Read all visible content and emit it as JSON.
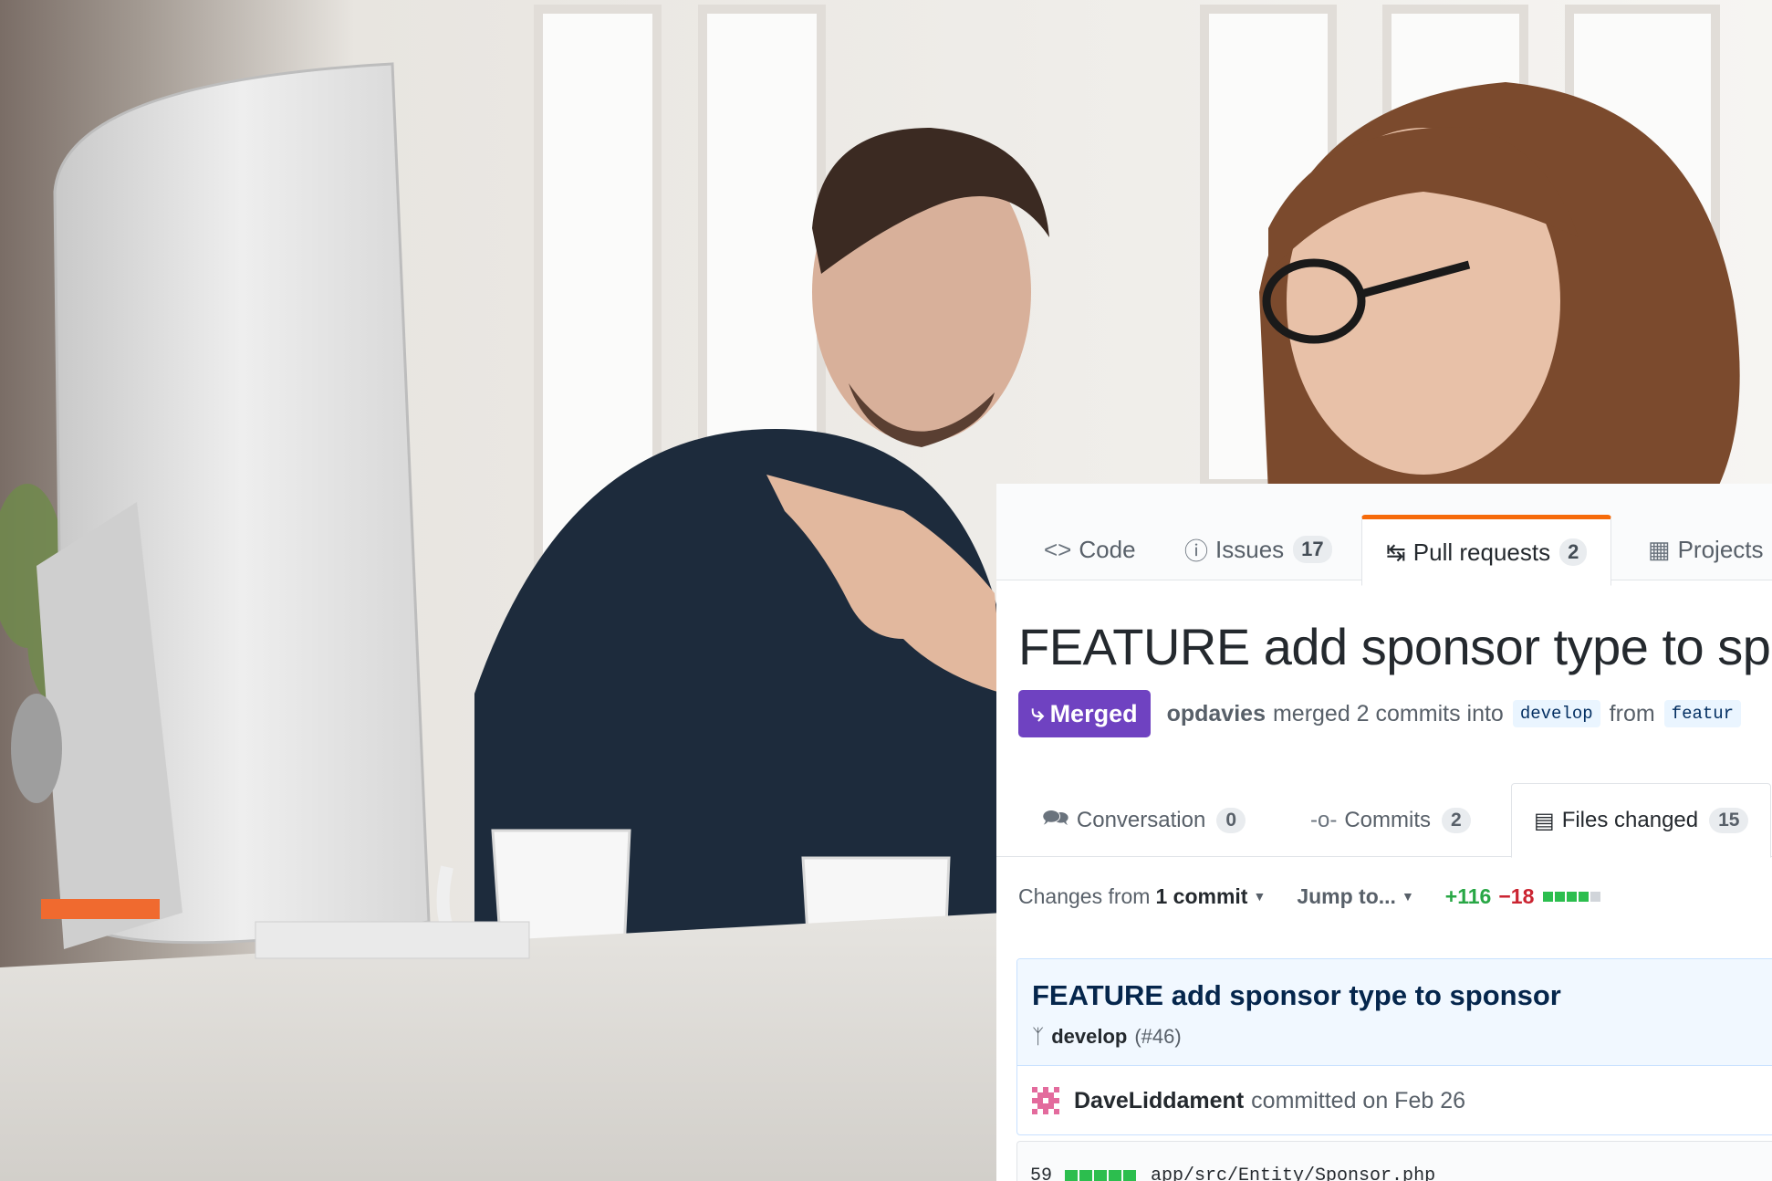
{
  "repo_tabs": {
    "code": {
      "label": "Code",
      "icon": "code-icon"
    },
    "issues": {
      "label": "Issues",
      "count": "17",
      "icon": "issue-opened-icon"
    },
    "pull_requests": {
      "label": "Pull requests",
      "count": "2",
      "icon": "git-pull-request-icon"
    },
    "projects": {
      "label": "Projects",
      "icon": "project-icon"
    }
  },
  "pr": {
    "title": "FEATURE add sponsor type to sp",
    "state": "Merged",
    "state_color": "#6f42c1",
    "author": "opdavies",
    "merge_text": "merged 2 commits into",
    "base_branch": "develop",
    "from_text": "from",
    "head_branch": "featur"
  },
  "pr_tabs": {
    "conversation": {
      "label": "Conversation",
      "count": "0",
      "icon": "comment-discussion-icon"
    },
    "commits": {
      "label": "Commits",
      "count": "2",
      "icon": "git-commit-icon"
    },
    "files_changed": {
      "label": "Files changed",
      "count": "15",
      "icon": "diff-icon"
    }
  },
  "toolbar": {
    "changes_from_prefix": "Changes from",
    "changes_from_value": "1 commit",
    "jump_to": "Jump to...",
    "additions": "+116",
    "deletions": "−18"
  },
  "commit": {
    "title": "FEATURE add sponsor type to sponsor",
    "branch": "develop",
    "ref": "(#46)",
    "author": "DaveLiddament",
    "committed_text": "committed on Feb 26"
  },
  "file": {
    "changes": "59",
    "path": "app/src/Entity/Sponsor.php"
  },
  "colors": {
    "accent_tab": "#f66a0a",
    "merged": "#6f42c1",
    "additions": "#28a745",
    "deletions": "#cb2431"
  }
}
